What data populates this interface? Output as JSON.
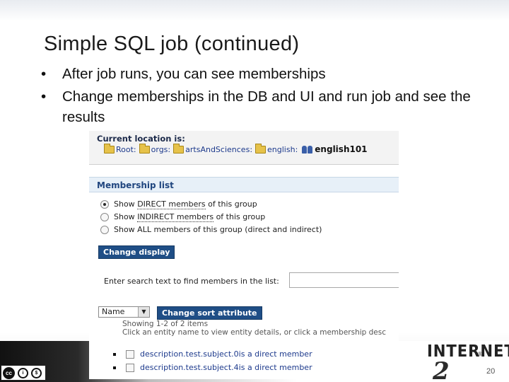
{
  "slide": {
    "title": "Simple SQL job (continued)",
    "bullets": [
      "After job runs, you can see memberships",
      "Change memberships in the DB and UI and run job and see the results"
    ],
    "page_number": "20"
  },
  "location": {
    "title": "Current location is:",
    "crumbs": [
      {
        "label": "Root",
        "icon": "folder-icon"
      },
      {
        "label": "orgs",
        "icon": "folder-icon"
      },
      {
        "label": "artsAndSciences",
        "icon": "folder-icon"
      },
      {
        "label": "english",
        "icon": "folder-icon"
      }
    ],
    "separator": ":",
    "current": "english101",
    "current_icon": "group-icon"
  },
  "membership": {
    "title": "Membership list",
    "options": [
      {
        "pre": "Show ",
        "emph": "DIRECT members",
        "post": " of this group",
        "checked": true
      },
      {
        "pre": "Show ",
        "emph": "INDIRECT members",
        "post": " of this group",
        "checked": false
      },
      {
        "pre": "Show ALL members of this group (direct and indirect)",
        "emph": "",
        "post": "",
        "checked": false
      }
    ],
    "change_display_label": "Change display",
    "search_label": "Enter search text to find members in the list:",
    "search_value": "",
    "sort_selected": "Name",
    "change_sort_label": "Change sort attribute",
    "showing_text": "Showing 1-2 of 2 items",
    "hint_text": "Click an entity name to view entity details, or click a membership desc",
    "members": [
      {
        "name": "description.test.subject.0",
        "rest": " is a direct member"
      },
      {
        "name": "description.test.subject.4",
        "rest": " is a direct member"
      }
    ]
  },
  "footer": {
    "logo_text": "INTERNET",
    "logo_mark": "®",
    "logo_number": "2",
    "license_badge": "cc",
    "license_icons": [
      "by-icon",
      "nc-icon"
    ]
  },
  "colors": {
    "link": "#1d3a8c",
    "button": "#1f4e86",
    "header_bg": "#e7f0f8"
  }
}
